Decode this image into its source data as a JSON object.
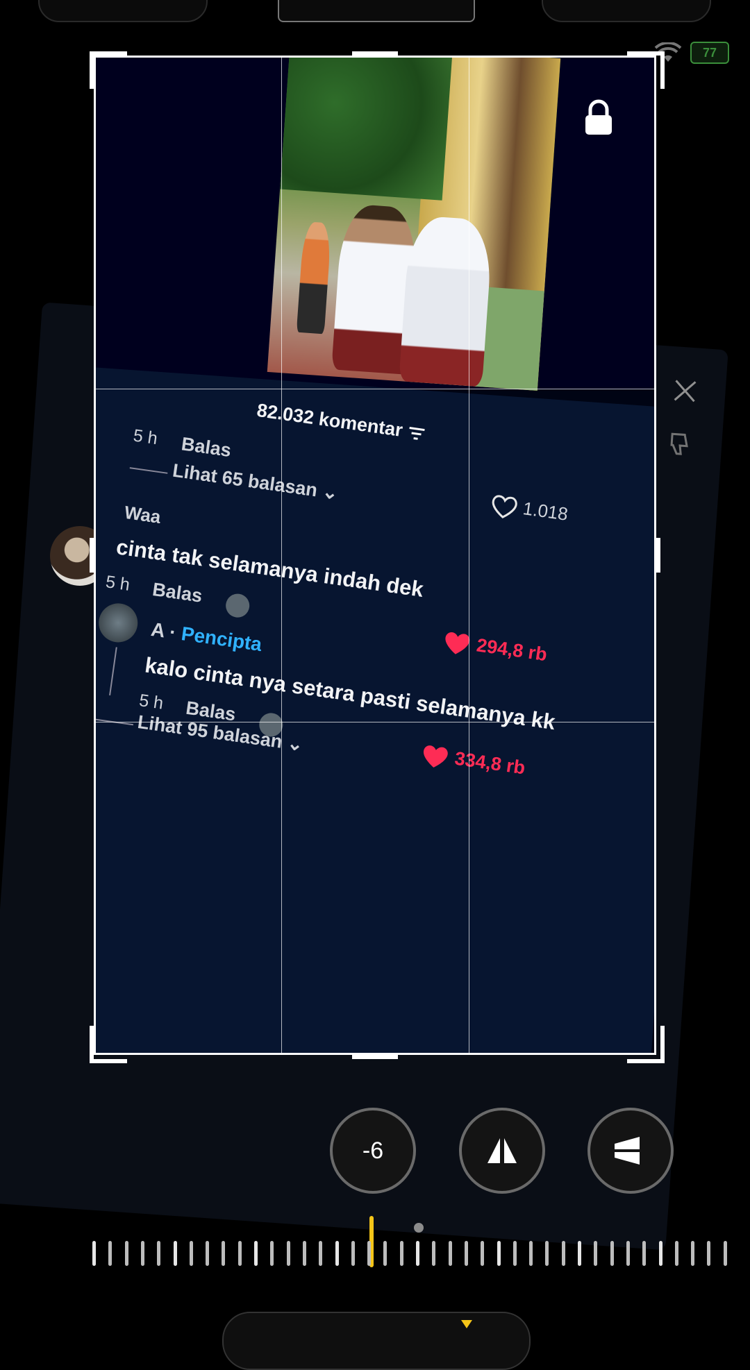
{
  "status": {
    "battery": "77"
  },
  "comments": {
    "count_label": "82.032 komentar",
    "reply_label": "Balas",
    "time_5h": "5 h",
    "see_65": "Lihat 65 balasan",
    "likes_1018": "1.018",
    "c1_user": "Waa",
    "c1_text": "cinta tak selamanya indah dek",
    "c1_likes": "294,8 rb",
    "c2_user": "A · ",
    "c2_badge": "Pencipta",
    "c2_text": "kalo cinta nya setara pasti selamanya kk",
    "c2_likes": "334,8 rb",
    "see_95": "Lihat 95 balasan"
  },
  "controls": {
    "rotation_value": "-6"
  },
  "colors": {
    "accent": "#fe2c55",
    "creator": "#30b2ff",
    "indicator": "#f5c518"
  },
  "icons": [
    "lock-icon",
    "close-icon",
    "heart-icon",
    "thumb-down-icon",
    "filter-icon",
    "flip-vertical-icon",
    "flip-horizontal-icon",
    "wifi-icon",
    "battery-icon"
  ]
}
